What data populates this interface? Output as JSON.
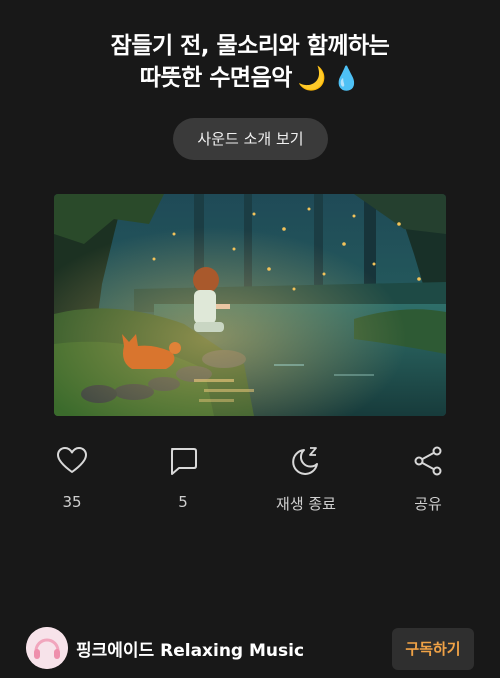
{
  "header": {
    "title_line1": "잠들기 전, 물소리와 함께하는",
    "title_line2": "따뜻한 수면음악",
    "title_emoji1": "🌙",
    "title_emoji2": "💧"
  },
  "intro_button": {
    "label": "사운드 소개 보기"
  },
  "thumbnail": {
    "icon": "forest-girl-cat-pond-illustration"
  },
  "actions": {
    "like": {
      "label": "35",
      "icon": "heart-icon"
    },
    "comment": {
      "label": "5",
      "icon": "comment-icon"
    },
    "sleep_timer": {
      "label": "재생 종료",
      "icon": "moon-zz-icon"
    },
    "share": {
      "label": "공유",
      "icon": "share-icon"
    }
  },
  "channel": {
    "name": "핑크에이드 Relaxing Music",
    "subscribe_label": "구독하기",
    "subscribe_color": "#f0a246"
  }
}
